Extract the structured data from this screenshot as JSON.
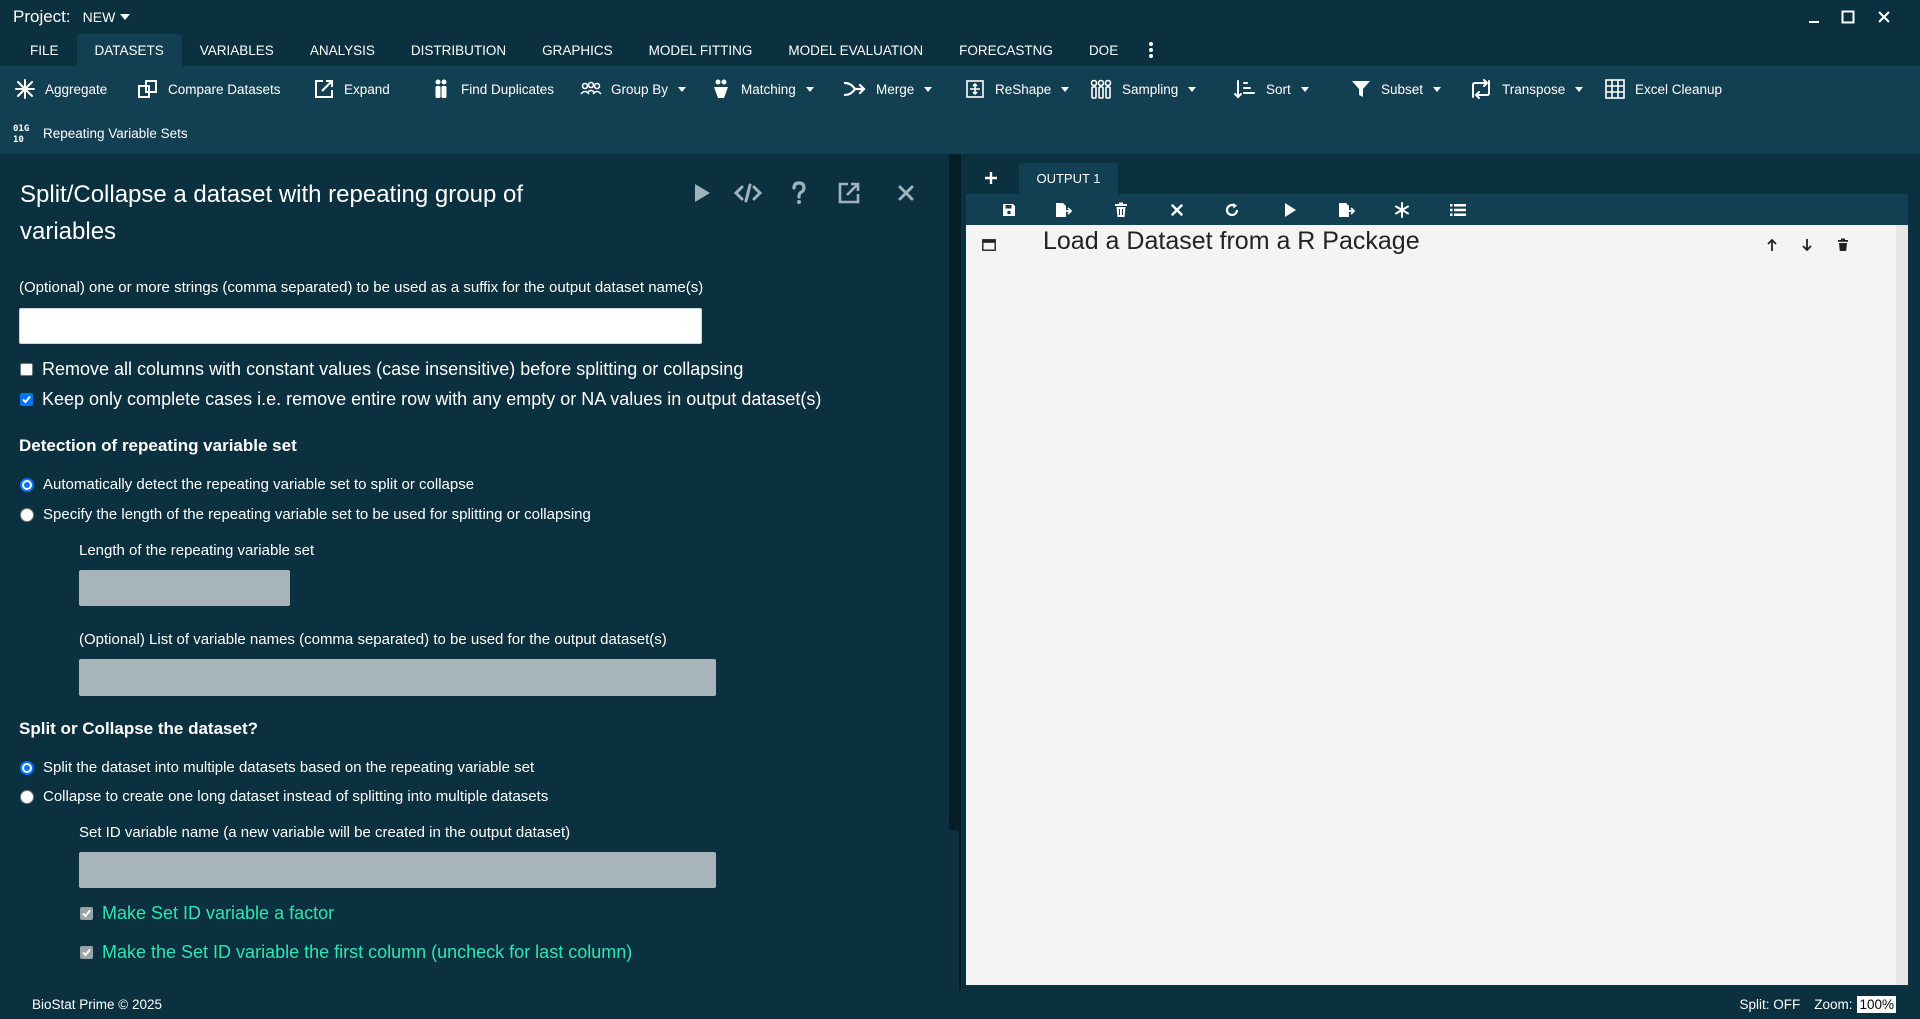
{
  "titlebar": {
    "project_label": "Project:",
    "project_value": "NEW"
  },
  "menu": {
    "tabs": [
      {
        "label": "FILE"
      },
      {
        "label": "DATASETS",
        "active": true
      },
      {
        "label": "VARIABLES"
      },
      {
        "label": "ANALYSIS"
      },
      {
        "label": "DISTRIBUTION"
      },
      {
        "label": "GRAPHICS"
      },
      {
        "label": "MODEL FITTING"
      },
      {
        "label": "MODEL EVALUATION"
      },
      {
        "label": "FORECASTNG"
      },
      {
        "label": "DOE"
      }
    ]
  },
  "ribbon": {
    "items": [
      {
        "label": "Aggregate",
        "icon": "aggregate-icon"
      },
      {
        "label": "Compare Datasets",
        "icon": "compare-icon"
      },
      {
        "label": "Expand",
        "icon": "expand-icon"
      },
      {
        "label": "Find Duplicates",
        "icon": "duplicates-icon"
      },
      {
        "label": "Group By",
        "icon": "group-icon",
        "dropdown": true
      },
      {
        "label": "Matching",
        "icon": "matching-icon",
        "dropdown": true
      },
      {
        "label": "Merge",
        "icon": "merge-icon",
        "dropdown": true
      },
      {
        "label": "ReShape",
        "icon": "reshape-icon",
        "dropdown": true
      },
      {
        "label": "Sampling",
        "icon": "sampling-icon",
        "dropdown": true
      },
      {
        "label": "Sort",
        "icon": "sort-icon",
        "dropdown": true
      },
      {
        "label": "Subset",
        "icon": "filter-icon",
        "dropdown": true
      },
      {
        "label": "Transpose",
        "icon": "transpose-icon",
        "dropdown": true
      },
      {
        "label": "Excel Cleanup",
        "icon": "grid-icon"
      },
      {
        "label": "Repeating Variable Sets",
        "icon": "binary-icon"
      }
    ]
  },
  "dialog": {
    "title": "Split/Collapse a dataset with repeating group of variables",
    "suffix_label": "(Optional) one or more strings (comma separated) to be used as a suffix for the output dataset name(s)",
    "suffix_value": "",
    "remove_constant_label": "Remove all columns with constant values (case insensitive) before splitting or collapsing",
    "remove_constant_checked": false,
    "complete_cases_label": "Keep only complete cases i.e. remove entire row with any empty or NA values in output dataset(s)",
    "complete_cases_checked": true,
    "detection_heading": "Detection of repeating variable set",
    "detect_auto_label": "Automatically detect the repeating variable set to split or collapse",
    "detect_length_label": "Specify the length of the repeating variable set to be used for splitting or collapsing",
    "length_label": "Length of the repeating variable set",
    "length_value": "",
    "varnames_label": "(Optional) List of variable names (comma separated) to be used for the output dataset(s)",
    "varnames_value": "",
    "split_heading": "Split or Collapse the dataset?",
    "split_label": "Split the dataset into multiple datasets based on the repeating variable set",
    "collapse_label": "Collapse to create one long dataset instead of splitting into multiple datasets",
    "setid_label": "Set ID variable name (a new variable will be created in the output dataset)",
    "setid_value": "",
    "factor_label": "Make Set ID variable a factor",
    "factor_checked": true,
    "firstcol_label": "Make the Set ID variable the first column (uncheck for last column)",
    "firstcol_checked": true
  },
  "output": {
    "tab_label": "OUTPUT 1",
    "heading": "Load a Dataset from a R Package"
  },
  "status": {
    "left": "BioStat Prime © 2025",
    "split": "Split: OFF",
    "zoom_label": "Zoom:",
    "zoom_value": "100%"
  },
  "colors": {
    "background": "#0b3040",
    "ribbon": "#133f52",
    "accent_green": "#2ee6b2",
    "check_blue": "#0075ff"
  }
}
